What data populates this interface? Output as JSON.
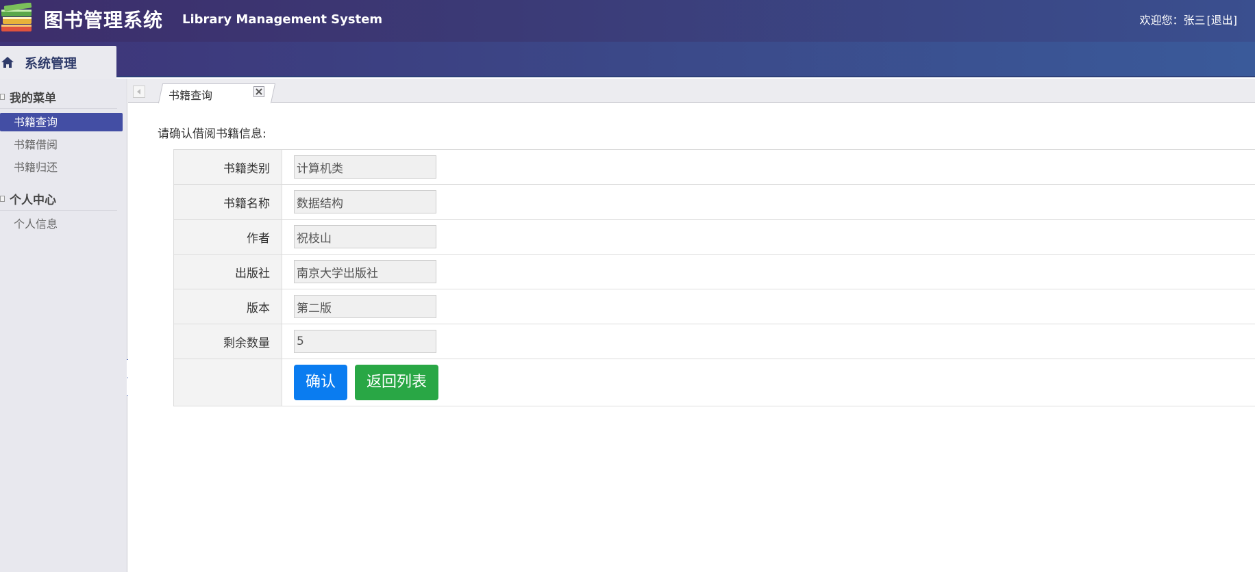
{
  "header": {
    "title": "图书管理系统",
    "subtitle": "Library Management System",
    "welcome_prefix": "欢迎您：张三",
    "logout_label": "[退出]"
  },
  "nav": {
    "tab_label": "系统管理"
  },
  "sidebar": {
    "groups": [
      {
        "label": "我的菜单",
        "items": [
          {
            "label": "书籍查询",
            "active": true
          },
          {
            "label": "书籍借阅",
            "active": false
          },
          {
            "label": "书籍归还",
            "active": false
          }
        ]
      },
      {
        "label": "个人中心",
        "items": [
          {
            "label": "个人信息",
            "active": false
          }
        ]
      }
    ]
  },
  "tabs": {
    "active_label": "书籍查询"
  },
  "form": {
    "heading": "请确认借阅书籍信息:",
    "rows": [
      {
        "label": "书籍类别",
        "value": "计算机类"
      },
      {
        "label": "书籍名称",
        "value": "数据结构"
      },
      {
        "label": "作者",
        "value": "祝枝山"
      },
      {
        "label": "出版社",
        "value": "南京大学出版社"
      },
      {
        "label": "版本",
        "value": "第二版"
      },
      {
        "label": "剩余数量",
        "value": "5"
      }
    ],
    "confirm_label": "确认",
    "back_label": "返回列表"
  },
  "colors": {
    "header_bg": "#3d2e6b",
    "active_menu": "#434ea4",
    "confirm_button": "#0a7cf0",
    "back_button": "#29a745"
  }
}
